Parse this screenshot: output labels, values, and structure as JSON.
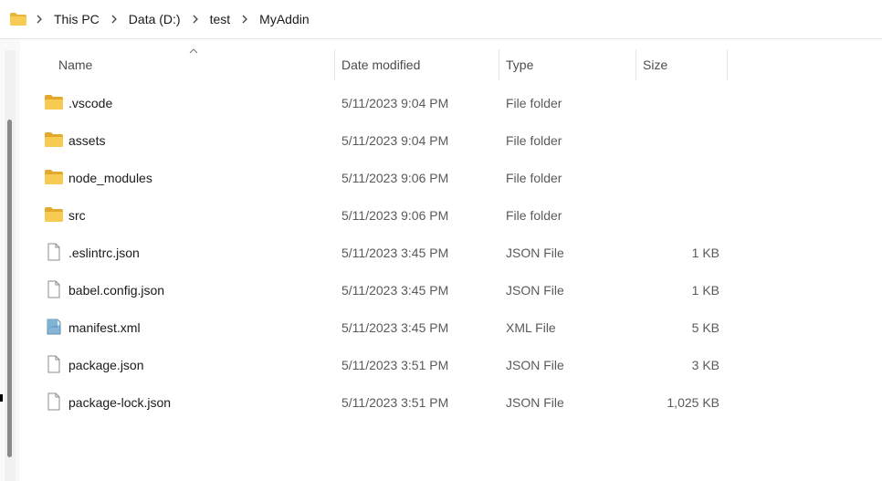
{
  "breadcrumb": {
    "items": [
      "This PC",
      "Data (D:)",
      "test",
      "MyAddin"
    ]
  },
  "columns": {
    "name": "Name",
    "date_modified": "Date modified",
    "type": "Type",
    "size": "Size"
  },
  "files": [
    {
      "name": ".vscode",
      "date": "5/11/2023 9:04 PM",
      "type": "File folder",
      "size": "",
      "icon": "folder-icon"
    },
    {
      "name": "assets",
      "date": "5/11/2023 9:04 PM",
      "type": "File folder",
      "size": "",
      "icon": "folder-icon"
    },
    {
      "name": "node_modules",
      "date": "5/11/2023 9:06 PM",
      "type": "File folder",
      "size": "",
      "icon": "folder-icon"
    },
    {
      "name": "src",
      "date": "5/11/2023 9:06 PM",
      "type": "File folder",
      "size": "",
      "icon": "folder-icon"
    },
    {
      "name": ".eslintrc.json",
      "date": "5/11/2023 3:45 PM",
      "type": "JSON File",
      "size": "1 KB",
      "icon": "file-icon"
    },
    {
      "name": "babel.config.json",
      "date": "5/11/2023 3:45 PM",
      "type": "JSON File",
      "size": "1 KB",
      "icon": "file-icon"
    },
    {
      "name": "manifest.xml",
      "date": "5/11/2023 3:45 PM",
      "type": "XML File",
      "size": "5 KB",
      "icon": "xml-file-icon"
    },
    {
      "name": "package.json",
      "date": "5/11/2023 3:51 PM",
      "type": "JSON File",
      "size": "3 KB",
      "icon": "file-icon"
    },
    {
      "name": "package-lock.json",
      "date": "5/11/2023 3:51 PM",
      "type": "JSON File",
      "size": "1,025 KB",
      "icon": "file-icon"
    }
  ],
  "colors": {
    "folder": "#f2c14e",
    "folder_dark": "#e0a828",
    "accent": "#0067c0"
  }
}
